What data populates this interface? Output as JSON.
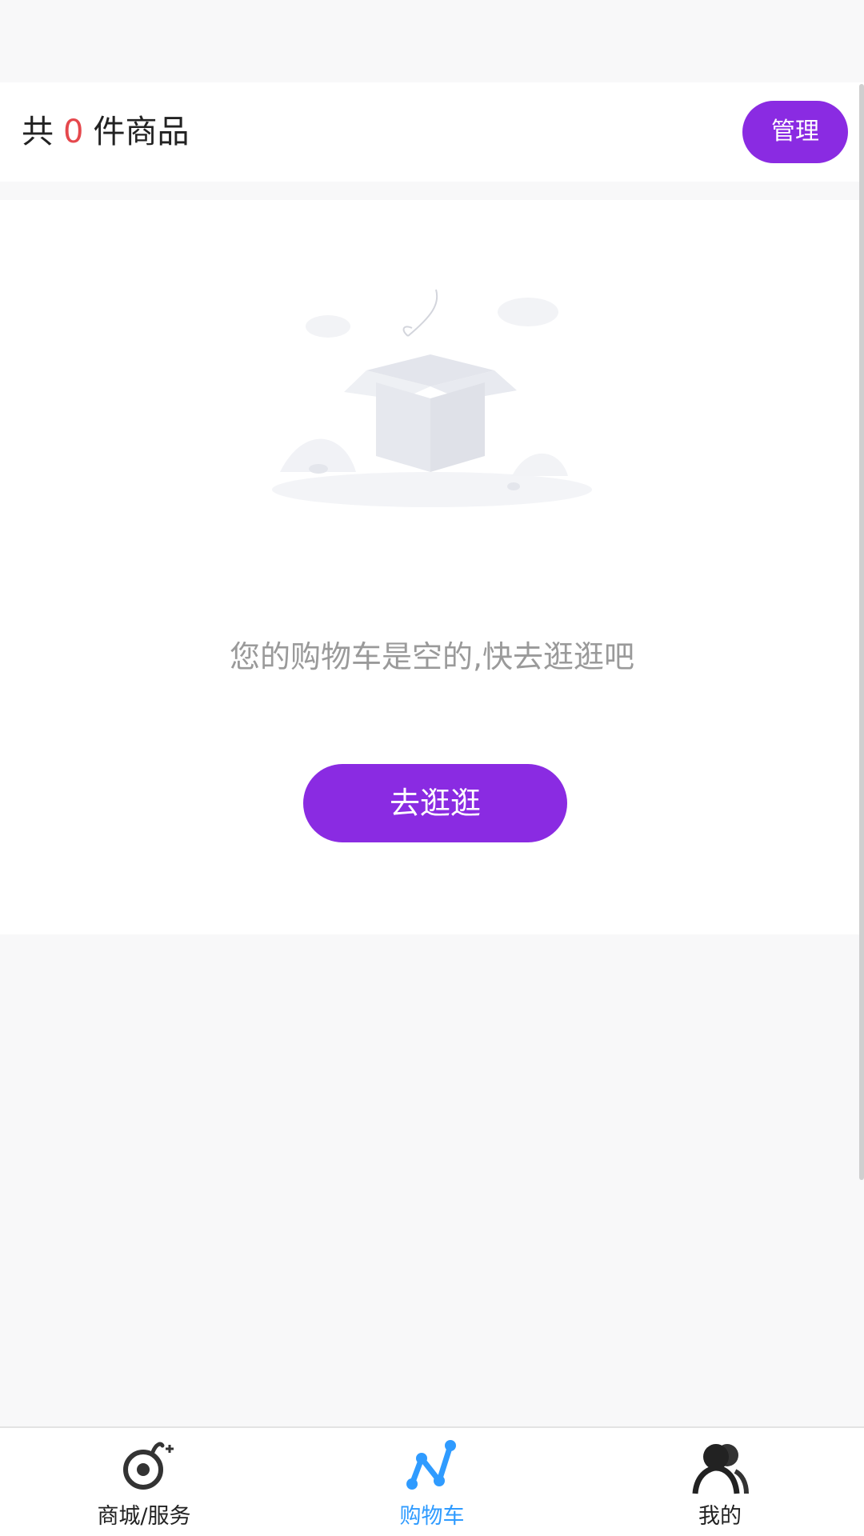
{
  "header": {
    "prefix": "共",
    "count": "0",
    "suffix": "件商品",
    "manage_label": "管理"
  },
  "empty": {
    "message": "您的购物车是空的,快去逛逛吧",
    "button_label": "去逛逛"
  },
  "tabbar": {
    "items": [
      {
        "label": "商城/服务",
        "icon": "snail-icon",
        "active": false
      },
      {
        "label": "购物车",
        "icon": "cart-graph-icon",
        "active": true
      },
      {
        "label": "我的",
        "icon": "user-icon",
        "active": false
      }
    ]
  },
  "colors": {
    "accent": "#8a2be2",
    "count": "#e5484d",
    "active_tab": "#2f9bff"
  }
}
